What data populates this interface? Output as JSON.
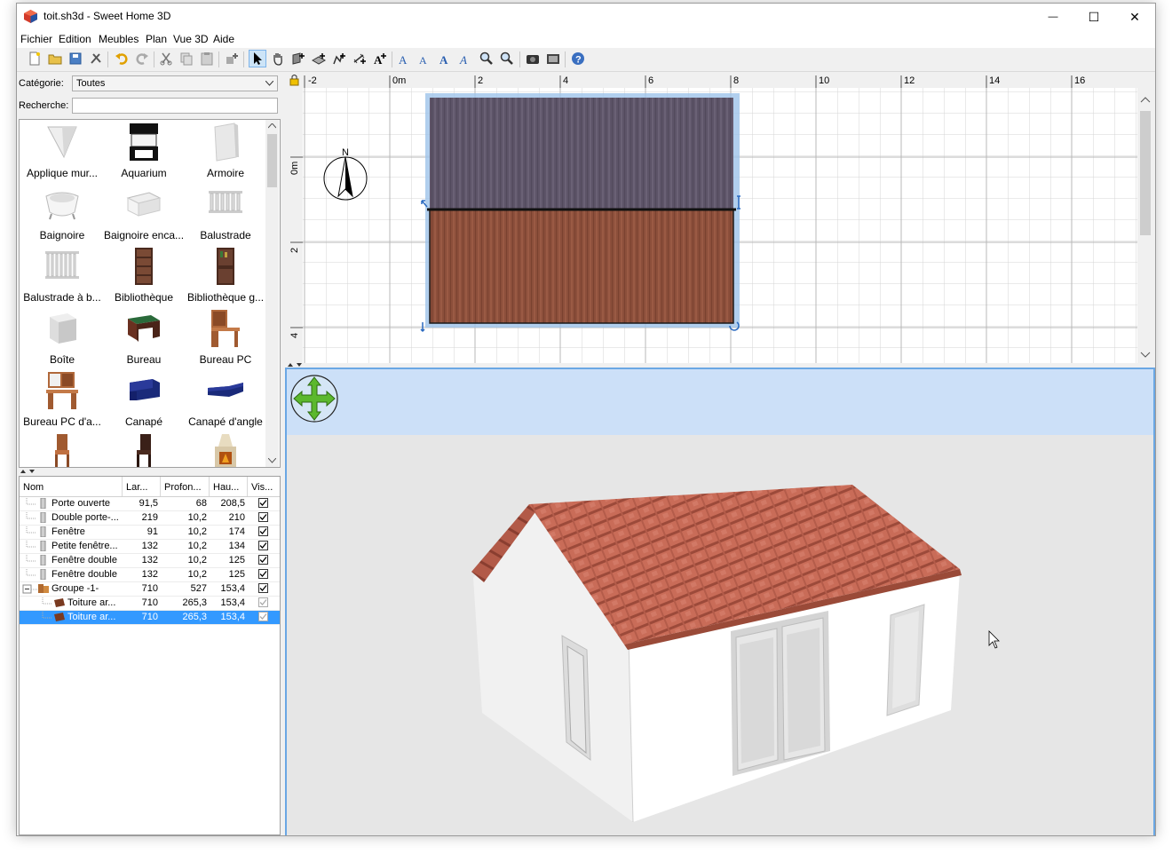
{
  "window": {
    "title": "toit.sh3d - Sweet Home 3D",
    "minimize_glyph": "—",
    "maximize_glyph": "☐",
    "close_glyph": "✕"
  },
  "menu": [
    "Fichier",
    "Edition",
    "Meubles",
    "Plan",
    "Vue 3D",
    "Aide"
  ],
  "toolbar_icons": [
    "new-file-icon",
    "open-file-icon",
    "save-icon",
    "cut-preferences-icon",
    "undo-icon",
    "redo-icon",
    "cut-icon",
    "copy-icon",
    "paste-icon",
    "add-furniture-icon",
    "select-mode-icon",
    "pan-mode-icon",
    "create-walls-icon",
    "create-rooms-icon",
    "create-polylines-icon",
    "create-dimensions-icon",
    "add-text-icon",
    "text-style-1-icon",
    "text-style-2-icon",
    "text-bold-icon",
    "text-italic-icon",
    "zoom-in-icon",
    "zoom-out-icon",
    "create-photo-icon",
    "create-video-icon",
    "help-icon"
  ],
  "catalog": {
    "category_label": "Catégorie:",
    "category_value": "Toutes",
    "search_label": "Recherche:",
    "search_value": "",
    "items": [
      {
        "label": "Applique mur...",
        "icon": "wall-lamp-icon"
      },
      {
        "label": "Aquarium",
        "icon": "aquarium-icon"
      },
      {
        "label": "Armoire",
        "icon": "wardrobe-icon"
      },
      {
        "label": "Baignoire",
        "icon": "bathtub-icon"
      },
      {
        "label": "Baignoire enca...",
        "icon": "built-in-bathtub-icon"
      },
      {
        "label": "Balustrade",
        "icon": "balustrade-icon"
      },
      {
        "label": "Balustrade à b...",
        "icon": "balustrade-bars-icon"
      },
      {
        "label": "Bibliothèque",
        "icon": "bookcase-icon"
      },
      {
        "label": "Bibliothèque g...",
        "icon": "bookcase-glass-icon"
      },
      {
        "label": "Boîte",
        "icon": "box-icon"
      },
      {
        "label": "Bureau",
        "icon": "desk-icon"
      },
      {
        "label": "Bureau PC",
        "icon": "pc-desk-icon"
      },
      {
        "label": "Bureau PC d'a...",
        "icon": "corner-pc-desk-icon"
      },
      {
        "label": "Canapé",
        "icon": "sofa-icon"
      },
      {
        "label": "Canapé d'angle",
        "icon": "corner-sofa-icon"
      },
      {
        "label": "",
        "icon": "chair-icon"
      },
      {
        "label": "",
        "icon": "chair-dark-icon"
      },
      {
        "label": "",
        "icon": "fireplace-icon"
      }
    ]
  },
  "furniture_table": {
    "headers": [
      "Nom",
      "Lar...",
      "Profon...",
      "Hau...",
      "Vis..."
    ],
    "rows": [
      {
        "name": "Porte ouverte",
        "w": "91,5",
        "d": "68",
        "h": "208,5",
        "visible": true,
        "level": 0,
        "selected": false
      },
      {
        "name": "Double porte-...",
        "w": "219",
        "d": "10,2",
        "h": "210",
        "visible": true,
        "level": 0,
        "selected": false
      },
      {
        "name": "Fenêtre",
        "w": "91",
        "d": "10,2",
        "h": "174",
        "visible": true,
        "level": 0,
        "selected": false
      },
      {
        "name": "Petite fenêtre...",
        "w": "132",
        "d": "10,2",
        "h": "134",
        "visible": true,
        "level": 0,
        "selected": false
      },
      {
        "name": "Fenêtre double",
        "w": "132",
        "d": "10,2",
        "h": "125",
        "visible": true,
        "level": 0,
        "selected": false
      },
      {
        "name": "Fenêtre double",
        "w": "132",
        "d": "10,2",
        "h": "125",
        "visible": true,
        "level": 0,
        "selected": false
      },
      {
        "name": "Groupe -1-",
        "w": "710",
        "d": "527",
        "h": "153,4",
        "visible": true,
        "level": 0,
        "selected": false
      },
      {
        "name": "Toiture ar...",
        "w": "710",
        "d": "265,3",
        "h": "153,4",
        "visible": true,
        "level": 1,
        "selected": false
      },
      {
        "name": "Toiture ar...",
        "w": "710",
        "d": "265,3",
        "h": "153,4",
        "visible": true,
        "level": 1,
        "selected": true
      }
    ]
  },
  "plan": {
    "ruler_x": [
      "-2",
      "0m",
      "2",
      "4",
      "6",
      "8",
      "10",
      "12",
      "14",
      "16"
    ],
    "ruler_y": [
      "0m",
      "2",
      "4"
    ],
    "compass_label": "N"
  },
  "colors": {
    "selection": "#3399ff",
    "plan_selection": "#9ec3ea",
    "view3d_sky": "#cce0f8",
    "view3d_ground": "#e6e6e6",
    "roof_tiles": "#c86a57",
    "roof_purple": "#5e5567",
    "roof_brown": "#8a4e3b"
  }
}
